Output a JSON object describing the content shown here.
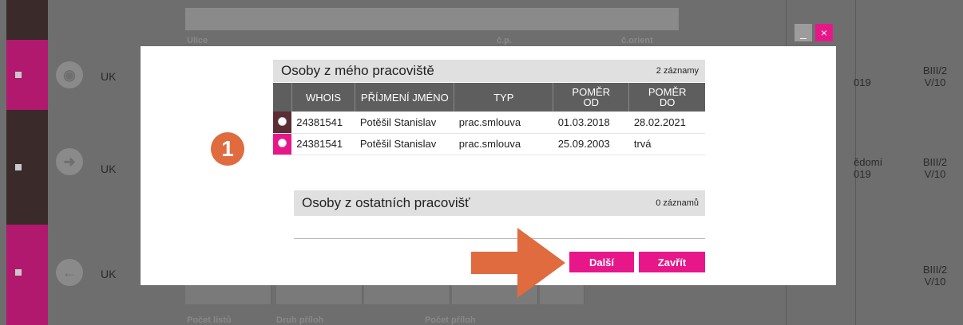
{
  "background": {
    "top_labels": [
      "Ulice",
      "č.p.",
      "č.orient"
    ],
    "bottom_labels": [
      "Počet listů",
      "Druh příloh",
      "Počet příloh"
    ],
    "rows": [
      {
        "code": "UK",
        "icon": "record-icon",
        "right_date": "019",
        "right_code_1": "BIII/2",
        "right_code_2": "V/10"
      },
      {
        "code": "UK",
        "icon": "arrow-right-circle-icon",
        "right_date_1": "ědomí",
        "right_date_2": "019",
        "right_code_1": "BIII/2",
        "right_code_2": "V/10"
      },
      {
        "code": "UK",
        "icon": "arrow-left-circle-icon",
        "right_code_1": "BIII/2",
        "right_code_2": "V/10"
      }
    ]
  },
  "window_controls": {
    "minimize": "_",
    "close": "×"
  },
  "modal": {
    "my_workplace": {
      "title": "Osoby z mého pracoviště",
      "count": "2 záznamy",
      "columns": {
        "whois": "WHOIS",
        "name": "PŘÍJMENÍ JMÉNO",
        "type": "TYP",
        "from_1": "POMĚR",
        "from_2": "OD",
        "to_1": "POMĚR",
        "to_2": "DO"
      },
      "rows": [
        {
          "whois": "24381541",
          "name": "Potěšil Stanislav",
          "type": "prac.smlouva",
          "from": "01.03.2018",
          "to": "28.02.2021"
        },
        {
          "whois": "24381541",
          "name": "Potěšil Stanislav",
          "type": "prac.smlouva",
          "from": "25.09.2003",
          "to": "trvá"
        }
      ]
    },
    "other_workplaces": {
      "title": "Osoby z ostatních pracovišť",
      "count": "0 záznamů"
    },
    "buttons": {
      "next": "Další",
      "close": "Zavřít"
    }
  },
  "annotation": {
    "step_number": "1",
    "arrow_color": "#df6b3f"
  },
  "colors": {
    "accent": "#e7178a",
    "header": "#5e5e5e",
    "panel": "#e0e0e0"
  }
}
